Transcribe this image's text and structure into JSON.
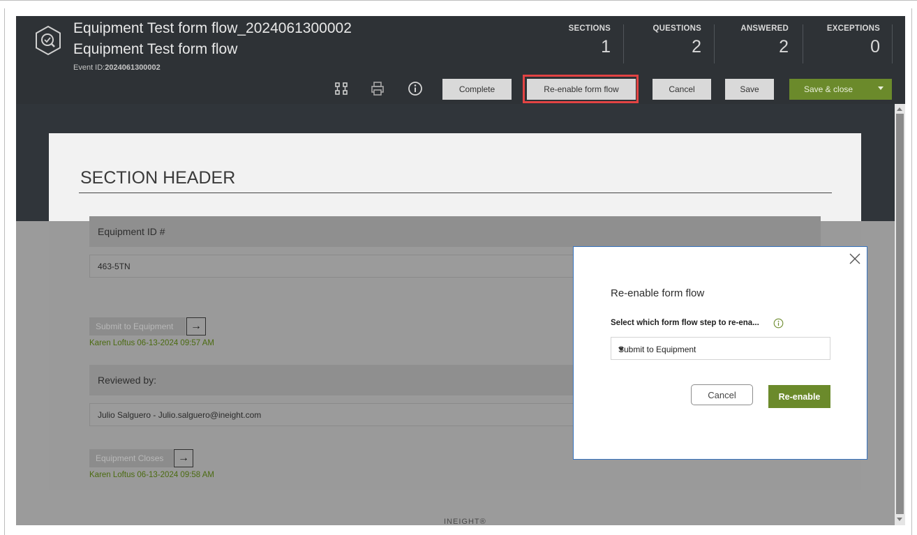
{
  "header": {
    "title_line1": "Equipment Test form flow_2024061300002",
    "title_line2": "Equipment Test form flow",
    "event_id_label": "Event ID:",
    "event_id_value": "2024061300002",
    "stats": [
      {
        "label": "SECTIONS",
        "value": "1"
      },
      {
        "label": "QUESTIONS",
        "value": "2"
      },
      {
        "label": "ANSWERED",
        "value": "2"
      },
      {
        "label": "EXCEPTIONS",
        "value": "0"
      }
    ]
  },
  "toolbar": {
    "icons": [
      "workflow-icon",
      "print-icon",
      "info-icon"
    ],
    "complete_label": "Complete",
    "reenable_label": "Re-enable form flow",
    "cancel_label": "Cancel",
    "save_label": "Save",
    "save_close_label": "Save & close"
  },
  "form": {
    "section_header": "SECTION HEADER",
    "questions": [
      {
        "label": "Equipment ID #",
        "value": "463-5TN"
      },
      {
        "label": "Reviewed by:",
        "value": "Julio Salguero - Julio.salguero@ineight.com"
      }
    ],
    "flow_steps": [
      {
        "label": "Submit to Equipment",
        "signoff": "Karen Loftus 06-13-2024 09:57 AM"
      },
      {
        "label": "Equipment Closes",
        "signoff": "Karen Loftus 06-13-2024 09:58 AM"
      }
    ]
  },
  "footer": {
    "brand": "INEIGHT®"
  },
  "modal": {
    "title": "Re-enable form flow",
    "select_label": "Select which form flow step to re-ena...",
    "selected_value": "Submit to Equipment",
    "cancel_label": "Cancel",
    "confirm_label": "Re-enable"
  },
  "colors": {
    "header_bg": "#2e3236",
    "accent_green": "#6b8a2b",
    "highlight_red": "#e34343",
    "modal_border": "#3573c0"
  }
}
